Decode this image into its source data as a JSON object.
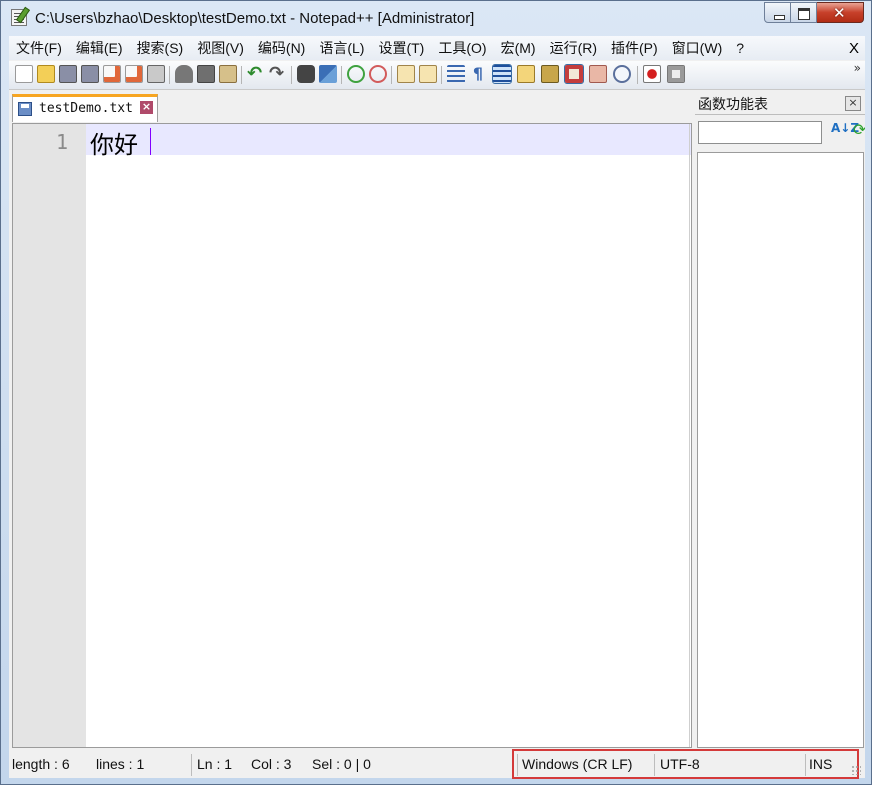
{
  "window": {
    "title": "C:\\Users\\bzhao\\Desktop\\testDemo.txt - Notepad++ [Administrator]"
  },
  "menubar": {
    "items": [
      "文件(F)",
      "编辑(E)",
      "搜索(S)",
      "视图(V)",
      "编码(N)",
      "语言(L)",
      "设置(T)",
      "工具(O)",
      "宏(M)",
      "运行(R)",
      "插件(P)",
      "窗口(W)",
      "?"
    ],
    "close_label": "X"
  },
  "toolbar": {
    "icons": [
      "new-file-icon",
      "open-file-icon",
      "save-icon",
      "save-all-icon",
      "close-icon",
      "close-all-icon",
      "print-icon",
      "cut-icon",
      "copy-icon",
      "paste-icon",
      "undo-icon",
      "redo-icon",
      "find-icon",
      "replace-icon",
      "zoom-in-icon",
      "zoom-out-icon",
      "sync-v-icon",
      "sync-h-icon",
      "word-wrap-icon",
      "show-all-chars-icon",
      "indent-guide-icon",
      "doc-map-icon",
      "function-list-icon",
      "folder-workspace-icon",
      "monitor-icon",
      "record-macro-icon",
      "stop-macro-icon"
    ],
    "selected": [
      "indent-guide-icon",
      "folder-workspace-icon"
    ],
    "overflow": "»"
  },
  "tabs": [
    {
      "label": "testDemo.txt",
      "close": "×",
      "active": true
    }
  ],
  "editor": {
    "line_numbers": [
      "1"
    ],
    "lines": [
      "你好"
    ]
  },
  "panel": {
    "title": "函数功能表",
    "close": "×",
    "search_placeholder": "",
    "sort_label": "A↓Z",
    "items": []
  },
  "statusbar": {
    "length": "length : 6",
    "lines": "lines : 1",
    "ln": "Ln : 1",
    "col": "Col : 3",
    "sel": "Sel : 0 | 0",
    "eol": "Windows (CR LF)",
    "encoding": "UTF-8",
    "mode": "INS"
  },
  "colors": {
    "tab_accent": "#f7a521",
    "current_line": "#e8e8ff",
    "caret": "#8000ff",
    "highlight_box": "#d43a3a"
  }
}
